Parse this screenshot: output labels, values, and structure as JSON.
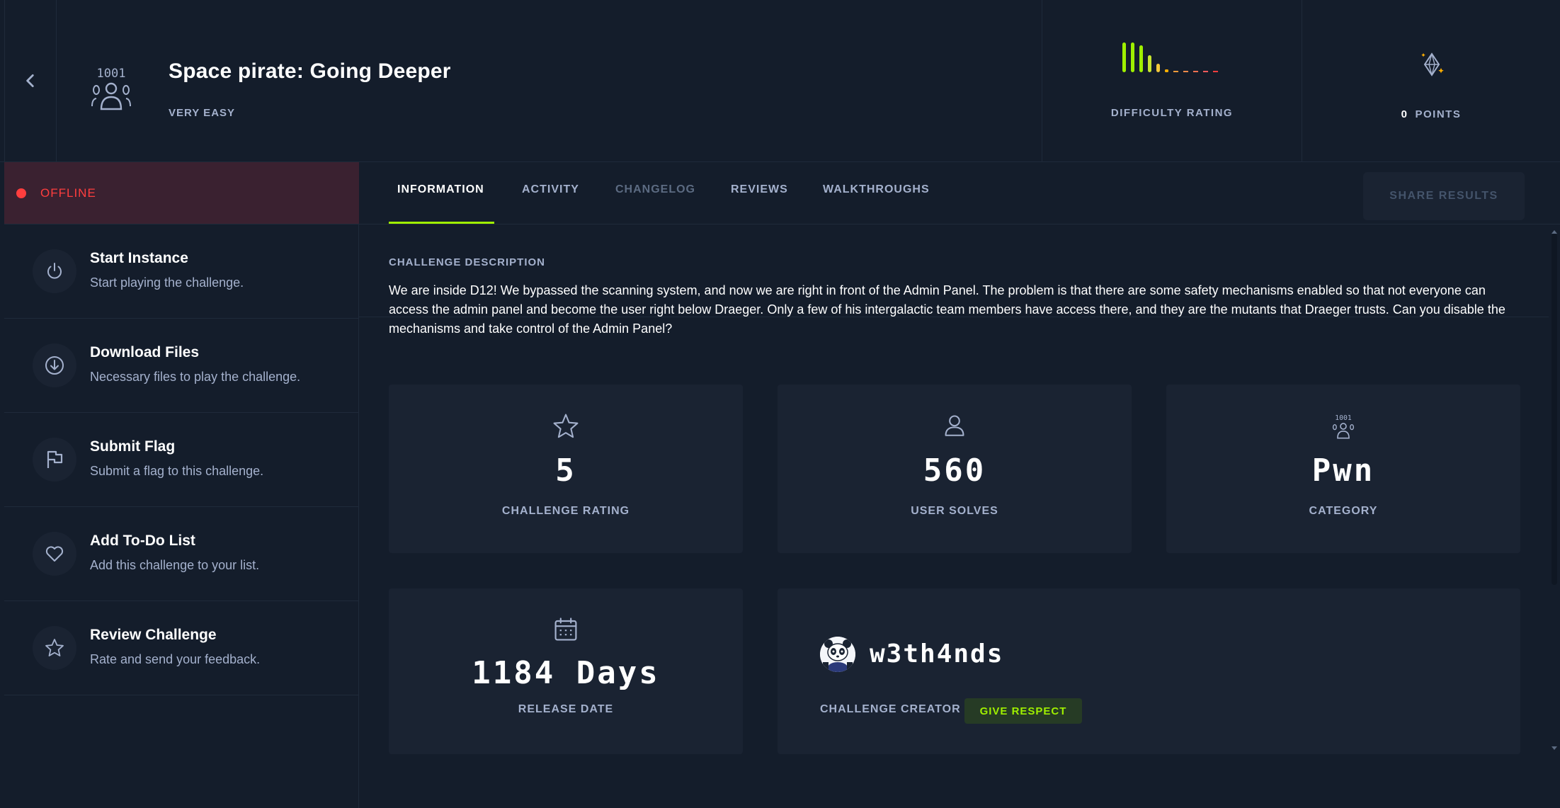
{
  "header": {
    "title": "Space pirate: Going Deeper",
    "difficulty": "VERY EASY",
    "difficulty_rating_label": "DIFFICULTY RATING",
    "points_value": "0",
    "points_label": "POINTS"
  },
  "status": {
    "text": "OFFLINE",
    "color": "#ff3e3e"
  },
  "actions": [
    {
      "title": "Start Instance",
      "desc": "Start playing the challenge.",
      "icon": "power-icon"
    },
    {
      "title": "Download Files",
      "desc": "Necessary files to play the challenge.",
      "icon": "download-icon"
    },
    {
      "title": "Submit Flag",
      "desc": "Submit a flag to this challenge.",
      "icon": "flag-icon"
    },
    {
      "title": "Add To-Do List",
      "desc": "Add this challenge to your list.",
      "icon": "heart-icon"
    },
    {
      "title": "Review Challenge",
      "desc": "Rate and send your feedback.",
      "icon": "star-icon"
    }
  ],
  "tabs": [
    {
      "label": "INFORMATION",
      "state": "active"
    },
    {
      "label": "ACTIVITY",
      "state": "normal"
    },
    {
      "label": "CHANGELOG",
      "state": "disabled"
    },
    {
      "label": "REVIEWS",
      "state": "normal"
    },
    {
      "label": "WALKTHROUGHS",
      "state": "normal"
    }
  ],
  "share_label": "SHARE RESULTS",
  "description": {
    "heading": "CHALLENGE DESCRIPTION",
    "text": "We are inside D12! We bypassed the scanning system, and now we are right in front of the Admin Panel. The problem is that there are some safety mechanisms enabled so that not everyone can access the admin panel and become the user right below Draeger. Only a few of his intergalactic team members have access there, and they are the mutants that Draeger trusts. Can you disable the mechanisms and take control of the Admin Panel?"
  },
  "stats": {
    "rating_value": "5",
    "rating_label": "CHALLENGE RATING",
    "solves_value": "560",
    "solves_label": "USER SOLVES",
    "category_value": "Pwn",
    "category_label": "CATEGORY",
    "release_value": "1184 Days",
    "release_label": "RELEASE DATE"
  },
  "creator": {
    "name": "w3th4nds",
    "label": "CHALLENGE CREATOR",
    "respect_label": "GIVE RESPECT"
  },
  "colors": {
    "accent": "#9fef00",
    "background": "#141d2b",
    "card": "#1a2332",
    "muted_text": "#a4b1cd"
  }
}
